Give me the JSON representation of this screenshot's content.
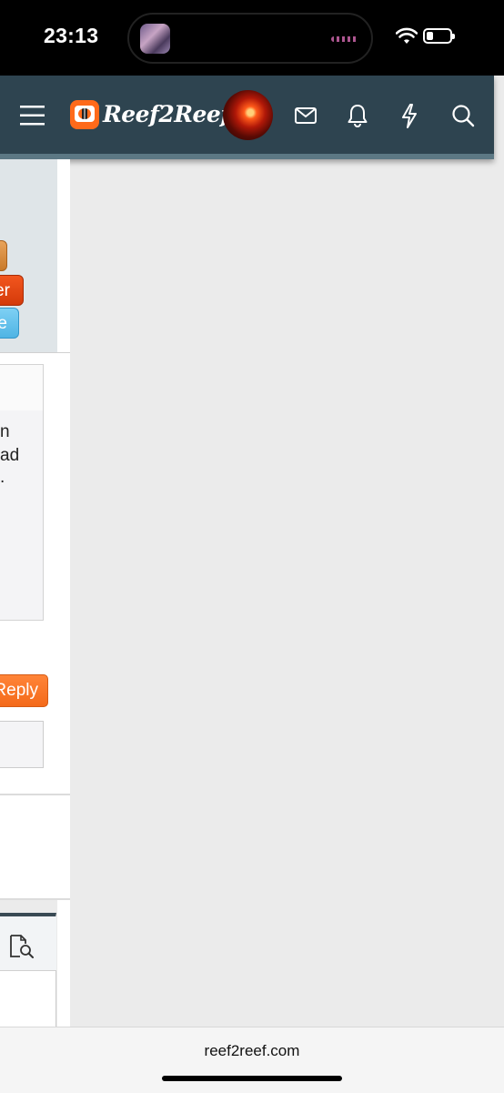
{
  "status_bar": {
    "time": "23:13",
    "icons": [
      "music-thumbnail-icon",
      "audio-wave-icon",
      "wifi-icon",
      "battery-icon"
    ]
  },
  "header": {
    "logo_text": "Reef2Reef",
    "icons": [
      "menu-icon",
      "reef2reef-logo-icon",
      "user-avatar",
      "mail-icon",
      "bell-icon",
      "lightning-icon",
      "search-icon"
    ],
    "colors": {
      "background": "#2e4450",
      "accent": "#5c7884"
    }
  },
  "sidebar_buttons": [
    {
      "label": "",
      "color": "#d98c3e"
    },
    {
      "label": "er",
      "color": "#e8481a"
    },
    {
      "label": "e",
      "color": "#5ec0ec"
    }
  ],
  "post_preview": {
    "lines": [
      "n",
      "ad",
      "."
    ]
  },
  "reply_button": {
    "label": "Reply",
    "color": "#f67524"
  },
  "tools": {
    "icons": [
      "document-search-icon"
    ]
  },
  "browser": {
    "url": "reef2reef.com"
  }
}
